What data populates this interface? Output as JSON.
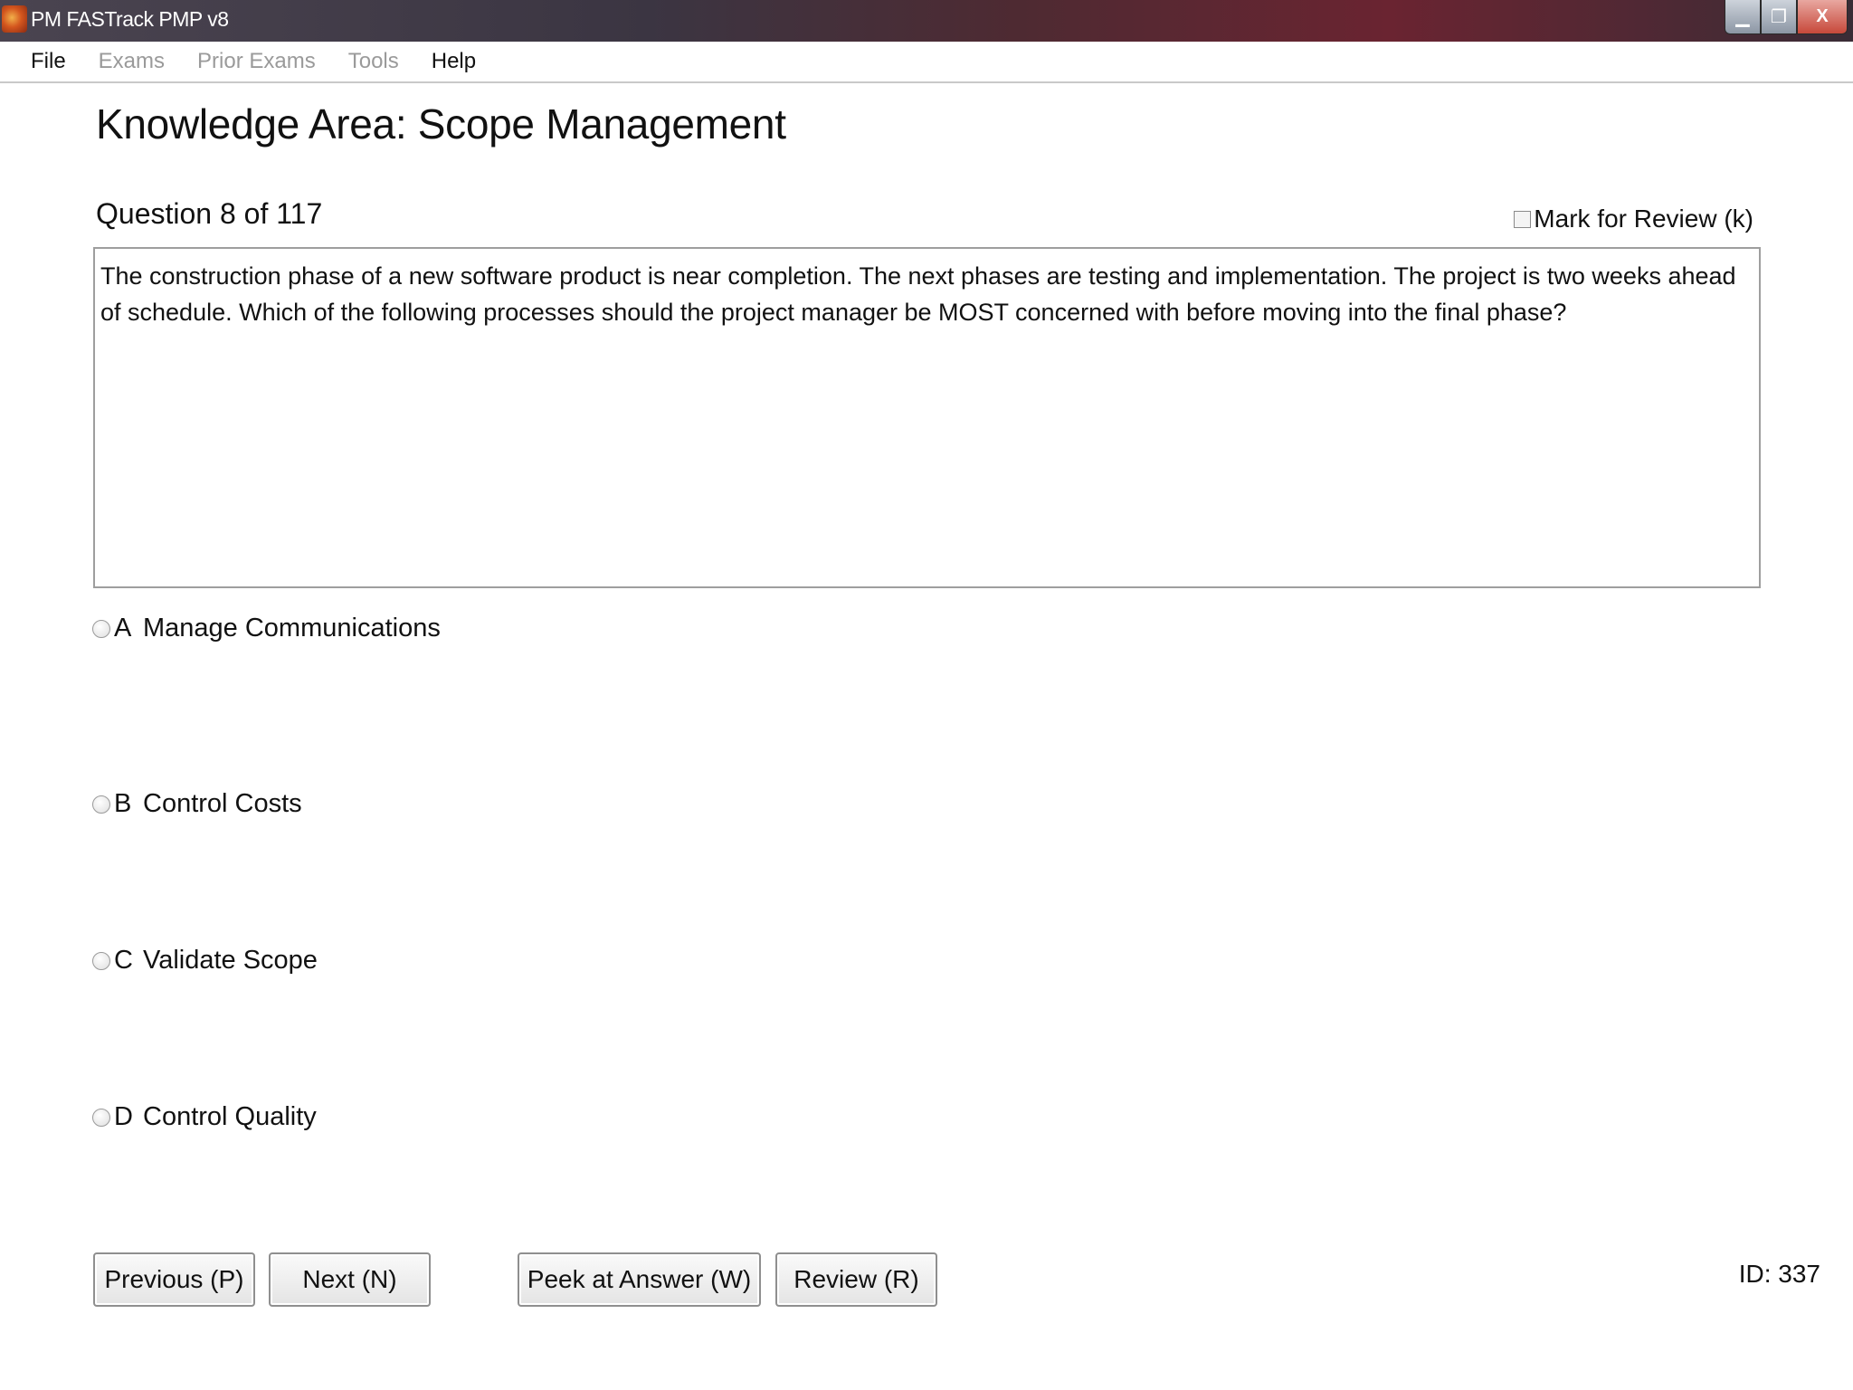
{
  "window": {
    "title": "PM FASTrack PMP v8",
    "controls": {
      "minimize": "▁",
      "restore": "❐",
      "close": "X"
    }
  },
  "menu": [
    {
      "label": "File",
      "enabled": true
    },
    {
      "label": "Exams",
      "enabled": false
    },
    {
      "label": "Prior Exams",
      "enabled": false
    },
    {
      "label": "Tools",
      "enabled": false
    },
    {
      "label": "Help",
      "enabled": true
    }
  ],
  "exam": {
    "heading": "Knowledge Area: Scope Management",
    "counter": "Question 8 of 117",
    "mark_for_review": {
      "label": "Mark for Review (k)",
      "checked": false
    },
    "question": "The construction phase of a new software product is near completion. The next phases are testing and implementation. The project is two weeks ahead of schedule. Which of the following processes should the project manager be MOST concerned with before moving into the final phase?",
    "answers": [
      {
        "letter": "A",
        "text": "Manage Communications",
        "selected": false
      },
      {
        "letter": "B",
        "text": "Control Costs",
        "selected": false
      },
      {
        "letter": "C",
        "text": "Validate Scope",
        "selected": false
      },
      {
        "letter": "D",
        "text": "Control Quality",
        "selected": false
      }
    ],
    "id_label": "ID: 337"
  },
  "buttons": {
    "previous": "Previous (P)",
    "next": "Next (N)",
    "peek": "Peek at Answer (W)",
    "review": "Review (R)"
  },
  "icons": {
    "app": "fastrack-app-icon",
    "minimize": "minimize-icon",
    "restore": "restore-icon",
    "close": "close-icon"
  },
  "colors": {
    "disabled_menu": "#9a9a9a",
    "border": "#9e9e9e"
  }
}
